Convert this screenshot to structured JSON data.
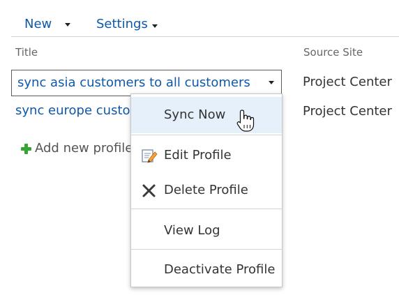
{
  "toolbar": {
    "new_label": "New",
    "settings_label": "Settings"
  },
  "columns": {
    "title": "Title",
    "source_site": "Source Site"
  },
  "rows": [
    {
      "title": "sync asia customers to all customers",
      "source_site": "Project Center"
    },
    {
      "title": "sync europe customers",
      "source_site": "Project Center"
    }
  ],
  "add_new_label": "Add new profile",
  "menu": {
    "items": [
      {
        "label": "Sync Now",
        "icon": ""
      },
      {
        "label": "Edit Profile",
        "icon": "edit-icon"
      },
      {
        "label": "Delete Profile",
        "icon": "delete-x-icon"
      },
      {
        "label": "View Log",
        "icon": ""
      },
      {
        "label": "Deactivate Profile",
        "icon": ""
      }
    ]
  },
  "colors": {
    "link": "#0f58a8",
    "menu_highlight": "#e6f0fa",
    "add_icon": "#36a534"
  }
}
